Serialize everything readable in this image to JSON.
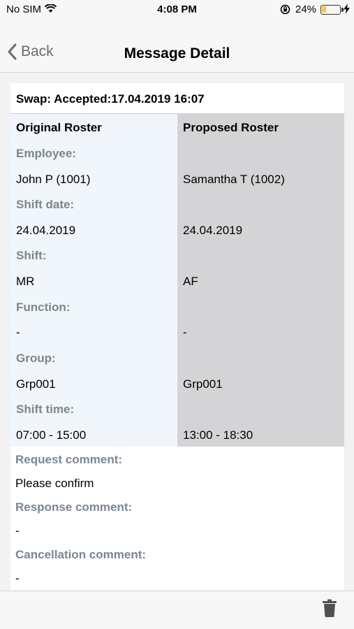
{
  "status_bar": {
    "carrier": "No SIM",
    "time": "4:08 PM",
    "battery_percent": "24%",
    "battery_level": 0.24
  },
  "nav": {
    "back_label": "Back",
    "title": "Message Detail"
  },
  "message": {
    "header": "Swap: Accepted:17.04.2019 16:07",
    "original": {
      "heading": "Original Roster",
      "employee": "John P (1001)",
      "shift_date": "24.04.2019",
      "shift": "MR",
      "function": "-",
      "group": "Grp001",
      "shift_time": "07:00 - 15:00"
    },
    "proposed": {
      "heading": "Proposed Roster",
      "employee": "Samantha T (1002)",
      "shift_date": "24.04.2019",
      "shift": "AF",
      "function": "-",
      "group": "Grp001",
      "shift_time": "13:00 - 18:30"
    },
    "labels": {
      "employee": "Employee:",
      "shift_date": "Shift date:",
      "shift": "Shift:",
      "function": "Function:",
      "group": "Group:",
      "shift_time": "Shift time:"
    },
    "comments": {
      "request_label": "Request comment:",
      "request_value": "Please confirm",
      "response_label": "Response comment:",
      "response_value": "-",
      "cancellation_label": "Cancellation comment:",
      "cancellation_value": "-"
    }
  },
  "icons": {
    "back": "chevron-left-icon",
    "delete": "trash-icon"
  },
  "colors": {
    "original_bg": "#f0f6fc",
    "proposed_bg": "#d4d4d7",
    "label": "#7c8591"
  }
}
